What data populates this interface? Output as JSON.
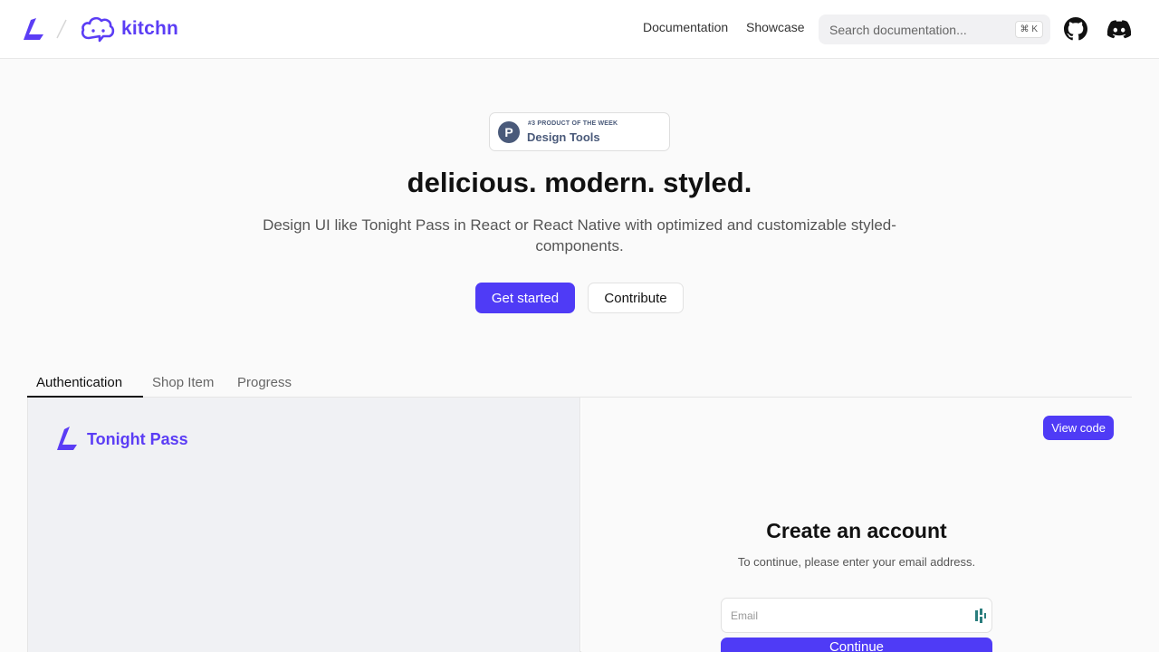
{
  "nav": {
    "brand": "kitchn",
    "links": {
      "documentation": "Documentation",
      "showcase": "Showcase"
    },
    "search": {
      "placeholder": "Search documentation...",
      "shortcut": "⌘ K"
    },
    "icons": {
      "github": "github-icon",
      "discord": "discord-icon"
    }
  },
  "hero": {
    "badge": {
      "small": "#3 PRODUCT OF THE WEEK",
      "big": "Design Tools",
      "letter": "P"
    },
    "title": "delicious. modern. styled.",
    "subtitle": "Design UI like Tonight Pass in React or React Native with optimized and customizable styled-components.",
    "primary_button": "Get started",
    "secondary_button": "Contribute"
  },
  "tabs": [
    "Authentication",
    "Shop Item",
    "Progress"
  ],
  "preview": {
    "brand": "Tonight Pass",
    "view_code": "View code",
    "title": "Create an account",
    "subtitle": "To continue, please enter your email address.",
    "email_placeholder": "Email",
    "continue": "Continue"
  },
  "colors": {
    "accent": "#4f3bf6",
    "brand": "#5b3df5"
  }
}
